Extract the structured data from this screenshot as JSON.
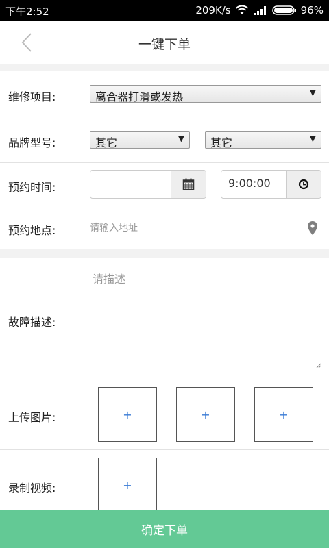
{
  "status_bar": {
    "time": "下午2:52",
    "speed": "209K/s",
    "battery": "96%"
  },
  "nav": {
    "title": "一键下单"
  },
  "form": {
    "repair_label": "维修项目:",
    "repair_value": "离合器打滑或发热",
    "brand_label": "品牌型号:",
    "brand_value": "其它",
    "model_value": "其它",
    "time_label": "预约时间:",
    "date_value": "",
    "time_value": "9:00:00",
    "location_label": "预约地点:",
    "location_placeholder": "请输入地址",
    "fault_label": "故障描述:",
    "fault_placeholder": "请描述",
    "upload_label": "上传图片:",
    "video_label": "录制视频:",
    "add_symbol": "+"
  },
  "submit_label": "确定下单",
  "colors": {
    "accent": "#63c995",
    "plus": "#3a7bd5"
  }
}
